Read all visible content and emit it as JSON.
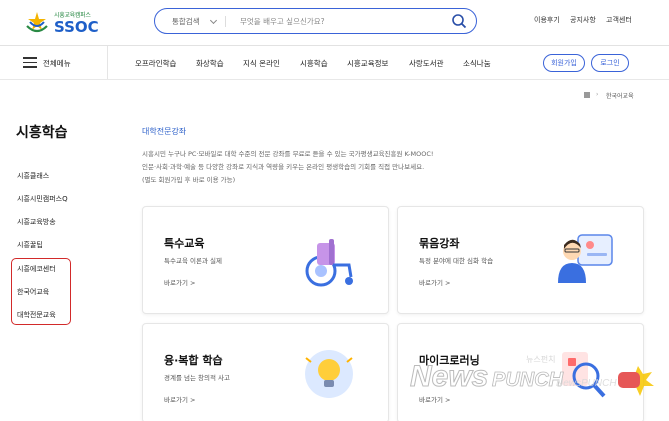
{
  "header": {
    "logo_sub": "시흥교육캠퍼스",
    "logo_main": "SSOC",
    "search": {
      "category": "통합검색",
      "placeholder": "무엇을 배우고 싶으신가요?"
    },
    "utility_links": [
      "이용후기",
      "공지사항",
      "고객센터"
    ]
  },
  "nav": {
    "all_menu": "전체메뉴",
    "items": [
      "오프라인학습",
      "화상학습",
      "지식 온라인",
      "시흥학습",
      "시흥교육정보",
      "사랑도서관",
      "소식나눔"
    ],
    "signup": "회원가입",
    "login": "로그인"
  },
  "breadcrumb": {
    "current": "한국어교육"
  },
  "sidebar": {
    "title": "시흥학습",
    "items": [
      "시흥클래스",
      "시흥시민캠퍼스Q",
      "시흥교육방송",
      "시흥꿀팁",
      "시흥에코센터",
      "한국어교육",
      "대학전문교육"
    ]
  },
  "main": {
    "section_label": "대학전문강좌",
    "intro_lines": [
      "시흥시민 누구나 PC·모바일로 대학 수준의 전문 강좌를 무료로 듣을 수 있는 국가평생교육진흥원 K-MOOC!",
      "인문·사회·과학·예술 등 다양한 강좌로 지식과 역량을 키우는 온라인 평생학습의 기회를 직접 만나보세요.",
      "(별도 회원가입 후 바로 이용 가능)"
    ],
    "cards": [
      {
        "title": "특수교육",
        "desc": "특수교육 이론과 실제",
        "link": "바로가기 >"
      },
      {
        "title": "묶음강좌",
        "desc": "특정 분야에 대한 심화 학습",
        "link": "바로가기 >"
      },
      {
        "title": "융·복합 학습",
        "desc": "경계를 넘는 창의적 사고",
        "link": "바로가기 >"
      },
      {
        "title": "마이크로러닝",
        "desc": "",
        "link": "바로가기 >"
      }
    ]
  },
  "watermark": {
    "text": "NewsPUNCH",
    "text_kr": "뉴스펀치"
  },
  "colors": {
    "brand_blue": "#1e5fc8",
    "brand_green": "#2a8a45",
    "accent_blue": "#3a63d8",
    "highlight_red": "#d22a2a"
  }
}
